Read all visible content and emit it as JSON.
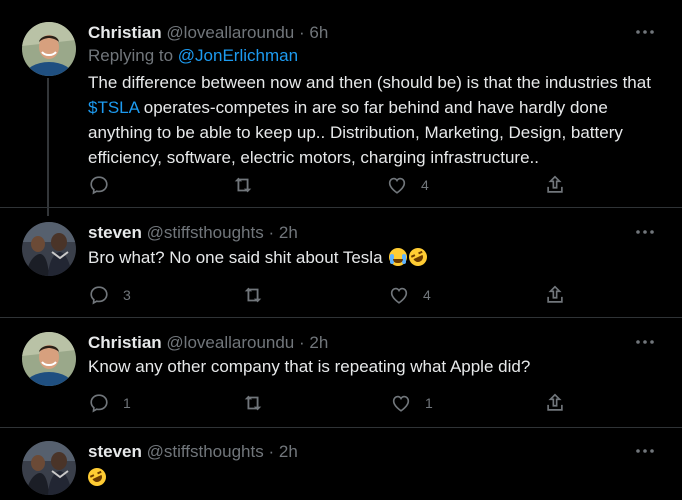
{
  "colors": {
    "background": "#000000",
    "text": "#e7e9ea",
    "muted": "#71767b",
    "link": "#1d9bf0",
    "divider": "#2f3336"
  },
  "tweets": [
    {
      "name": "Christian",
      "handle": "@loveallaroundu",
      "dot": "·",
      "time": "6h",
      "replying_prefix": "Replying to ",
      "replying_to": "@JonErlichman",
      "text_before_cashtag": "The difference between now and then (should be) is that the industries that ",
      "cashtag": "$TSLA",
      "text_after_cashtag": " operates-competes in are so far behind and have hardly done anything to be able to keep up.. Distribution, Marketing, Design, battery efficiency, software, electric motors, charging infrastructure..",
      "reply_count": "",
      "retweet_count": "",
      "like_count": "4",
      "icons": [
        "reply-icon",
        "retweet-icon",
        "like-icon",
        "share-icon",
        "more-icon"
      ]
    },
    {
      "name": "steven",
      "handle": "@stiffsthoughts",
      "dot": "·",
      "time": "2h",
      "text": "Bro what? No one said shit about Tesla ",
      "emojis": [
        "loudly-crying-face",
        "rolling-on-floor-laughing"
      ],
      "reply_count": "3",
      "retweet_count": "",
      "like_count": "4"
    },
    {
      "name": "Christian",
      "handle": "@loveallaroundu",
      "dot": "·",
      "time": "2h",
      "text": "Know any other company that is repeating what Apple did?",
      "reply_count": "1",
      "retweet_count": "",
      "like_count": "1"
    },
    {
      "name": "steven",
      "handle": "@stiffsthoughts",
      "dot": "·",
      "time": "2h",
      "emojis": [
        "rolling-on-floor-laughing"
      ]
    }
  ]
}
